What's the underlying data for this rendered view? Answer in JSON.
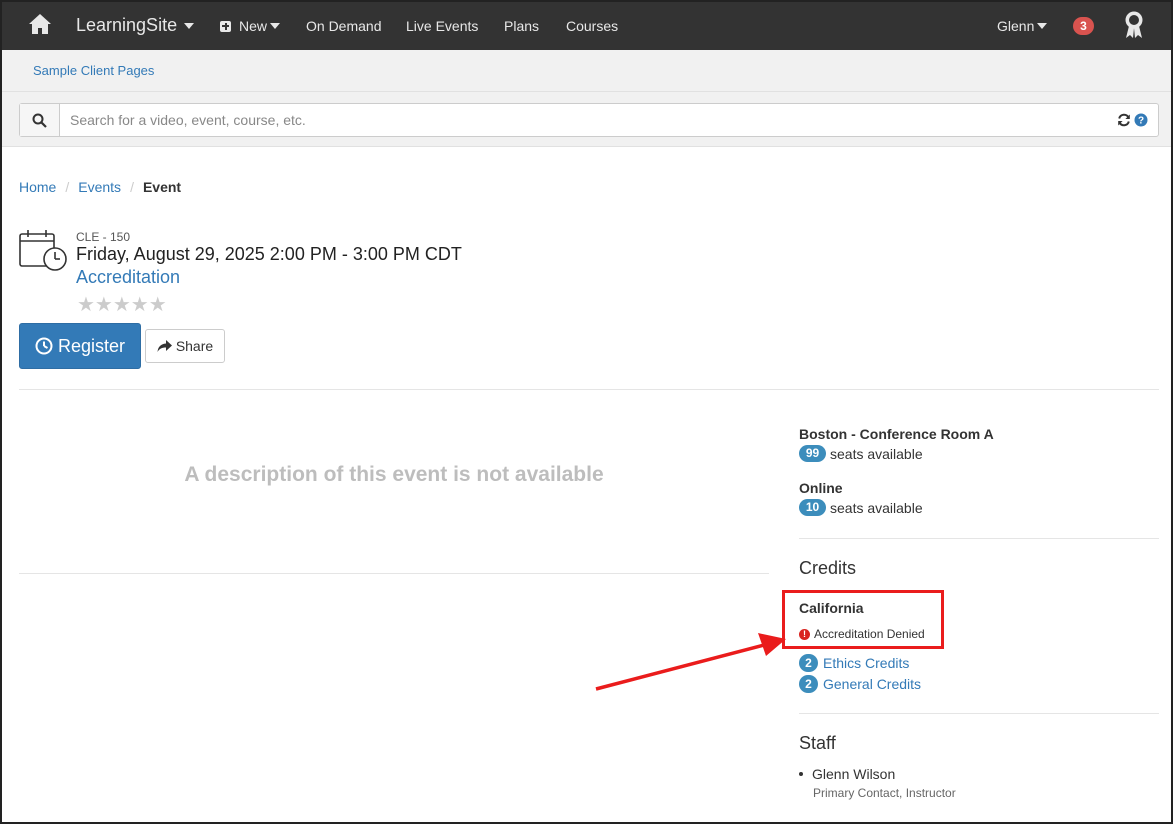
{
  "topnav": {
    "brand": "LearningSite",
    "new_label": "New",
    "items": [
      "On Demand",
      "Live Events",
      "Plans",
      "Courses"
    ],
    "user": "Glenn",
    "notifications": "3"
  },
  "subnav": {
    "link": "Sample Client Pages"
  },
  "search": {
    "placeholder": "Search for a video, event, course, etc."
  },
  "breadcrumb": {
    "home": "Home",
    "events": "Events",
    "current": "Event",
    "separator": "/"
  },
  "event": {
    "code": "CLE - 150",
    "date": "Friday, August 29, 2025 2:00 PM - 3:00 PM CDT",
    "title": "Accreditation",
    "stars": "★★★★★",
    "rating": 0,
    "register_label": "Register",
    "share_label": "Share",
    "description_placeholder": "A description of this event is not available"
  },
  "locations": [
    {
      "name": "Boston - Conference Room A",
      "seats": "99",
      "seats_text": "seats available"
    },
    {
      "name": "Online",
      "seats": "10",
      "seats_text": "seats available"
    }
  ],
  "credits": {
    "heading": "Credits",
    "state": "California",
    "status": "Accreditation Denied",
    "items": [
      {
        "count": "2",
        "label": "Ethics Credits"
      },
      {
        "count": "2",
        "label": "General Credits"
      }
    ]
  },
  "staff": {
    "heading": "Staff",
    "members": [
      {
        "name": "Glenn Wilson",
        "role": "Primary Contact, Instructor"
      }
    ]
  },
  "colors": {
    "navbar": "#333333",
    "link": "#337ab7",
    "primary_button": "#337ab7",
    "badge": "#3c8dbc",
    "notification": "#d9534f",
    "annotation": "#ea1c1c"
  },
  "icons": {
    "home": "home-icon",
    "new": "plus-square-icon",
    "search": "search-icon",
    "refresh": "refresh-icon",
    "help": "question-circle-icon",
    "award": "award-ribbon-icon",
    "calendar": "calendar-clock-icon",
    "register": "clock-icon",
    "share": "share-arrow-icon",
    "alert": "exclamation-circle-icon"
  }
}
